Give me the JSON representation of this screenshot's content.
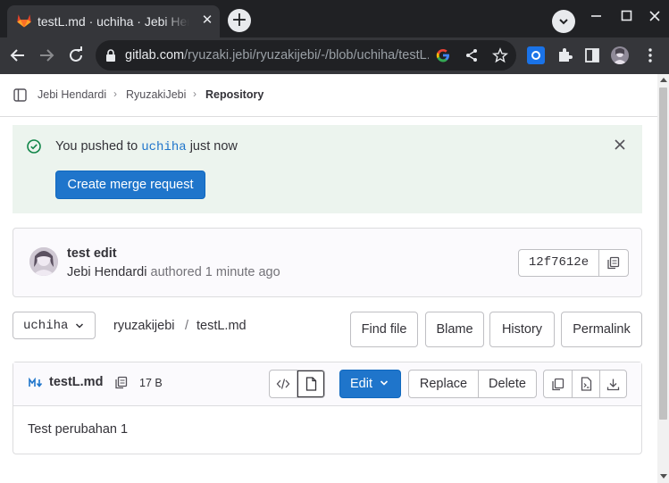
{
  "browser": {
    "tab_title": "testL.md · uchiha · Jebi Hendardi / RyuzakiJebi · GitLab",
    "url_host": "gitlab.com",
    "url_path": "/ryuzaki.jebi/ryuzakijebi/-/blob/uchiha/testL.md"
  },
  "breadcrumbs": {
    "items": [
      "Jebi Hendardi",
      "RyuzakiJebi",
      "Repository"
    ],
    "separator": "›"
  },
  "alert": {
    "prefix": "You pushed to",
    "branch": "uchiha",
    "suffix": "just now",
    "button": "Create merge request"
  },
  "commit": {
    "title": "test edit",
    "author": "Jebi Hendardi",
    "action": "authored",
    "time": "1 minute ago",
    "sha": "12f7612e"
  },
  "repo_nav": {
    "ref": "uchiha",
    "project": "ryuzakijebi",
    "path_sep": "/",
    "file": "testL.md",
    "buttons": [
      "Find file",
      "Blame",
      "History",
      "Permalink"
    ]
  },
  "file": {
    "name": "testL.md",
    "size": "17 B",
    "edit_label": "Edit",
    "replace_label": "Replace",
    "delete_label": "Delete",
    "content": "Test perubahan 1"
  },
  "colors": {
    "primary": "#1f75cb",
    "alert_bg": "#ecf4ee",
    "success": "#108548"
  }
}
